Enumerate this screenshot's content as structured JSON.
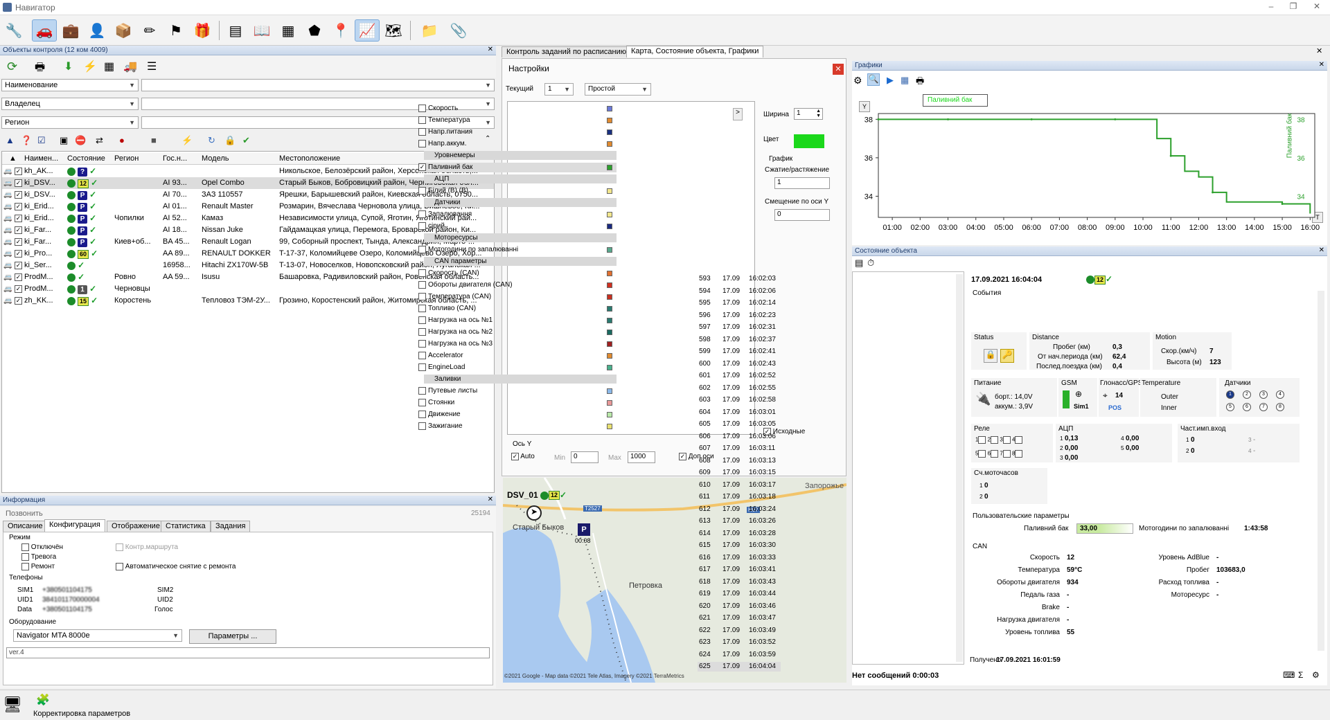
{
  "app": {
    "title": "Навигатор",
    "min": "–",
    "max": "❐",
    "close": "✕"
  },
  "toolbar": {
    "icons": [
      "wrench-icon",
      "car-icon",
      "briefcase-icon",
      "driver-icon",
      "box-icon",
      "wand-icon",
      "flag-icon",
      "parcel-icon",
      "calculator-icon",
      "book-icon",
      "graph-grid-icon",
      "shield-icon",
      "map-pin-icon",
      "chart-icon",
      "map-icon",
      "folder-icon",
      "paperclip-icon"
    ]
  },
  "objects": {
    "header": "Объекты контроля (12 ком 4009)",
    "filters": [
      {
        "label": "Наименование",
        "value": ""
      },
      {
        "label": "Владелец",
        "value": ""
      },
      {
        "label": "Регион",
        "value": ""
      }
    ],
    "columns": [
      "Наимен...",
      "Состояние",
      "Регион",
      "Гос.н...",
      "Модель",
      "Местоположение"
    ],
    "rows": [
      {
        "name": "kh_AK...",
        "st": "?",
        "region": "",
        "gos": "",
        "model": "",
        "loc": "Никольское, Белозёрский район, Херсонская область,..."
      },
      {
        "name": "ki_DSV...",
        "st": "12",
        "region": "",
        "gos": "AI 93...",
        "model": "Opel Combo",
        "loc": "Старый Быков, Бобровицкий район, Черниговская обл..."
      },
      {
        "name": "ki_DSV...",
        "st": "P",
        "region": "",
        "gos": "AI 70...",
        "model": "ЗАЗ  110557",
        "loc": "Ярешки, Барышевский район, Киевская область, 0750..."
      },
      {
        "name": "ki_Erid...",
        "st": "P",
        "region": "",
        "gos": "AI 01...",
        "model": "Renault Master",
        "loc": "Розмарин, Вячеслава Черновола улица, Вишнёвое, Ки..."
      },
      {
        "name": "ki_Erid...",
        "st": "P",
        "region": "Чопилки",
        "gos": "AI 52...",
        "model": "Камаз",
        "loc": "Независимости улица, Супой, Яготин, Яготинский рай..."
      },
      {
        "name": "ki_Far...",
        "st": "P",
        "region": "",
        "gos": "AI 18...",
        "model": "Nissan Juke",
        "loc": "Гайдамацкая улица, Перемога, Броварской район, Ки..."
      },
      {
        "name": "ki_Far...",
        "st": "P",
        "region": "Киев+об...",
        "gos": "BA 45...",
        "model": "Renault Logan",
        "loc": "99, Соборный проспект, Тында, Александрия, Марто-..."
      },
      {
        "name": "ki_Pro...",
        "st": "60",
        "region": "",
        "gos": "AA 89...",
        "model": "RENAULT DOKKER",
        "loc": "T-17-37, Коломийцеве Озеро, Коломийцево Озеро, Хор..."
      },
      {
        "name": "ki_Ser...",
        "st": "",
        "region": "",
        "gos": "16958...",
        "model": "Hitachi ZX170W-5B",
        "loc": "T-13-07, Новоселков, Новопсковский район, Луганская ..."
      },
      {
        "name": "ProdM...",
        "st": "",
        "region": "Ровно",
        "gos": "AA 59...",
        "model": "Isusu",
        "loc": "Башаровка, Радивиловский район, Ровенская область..."
      },
      {
        "name": "ProdM...",
        "st": "1",
        "region": "Черновцы",
        "gos": "",
        "model": "",
        "loc": ""
      },
      {
        "name": "zh_KK...",
        "st": "15",
        "region": "Коростень",
        "gos": "",
        "model": "Тепловоз ТЭМ-2У...",
        "loc": "Грозино, Коростенский район, Житомирская область, ..."
      }
    ]
  },
  "info": {
    "header": "Информация",
    "call": "Позвонить",
    "id": "25194",
    "tabs": [
      "Описание",
      "Конфигурация",
      "Отображение",
      "Статистика",
      "Задания"
    ],
    "mode_title": "Режим",
    "modes": [
      "Отключён",
      "Тревога",
      "Ремонт"
    ],
    "route": "Контр.маршрута",
    "auto": "Автоматическое снятие с ремонта",
    "phones_title": "Телефоны",
    "sim1": "SIM1",
    "sim1_val": "+380501104175",
    "uid1": "UID1",
    "uid1_val": "384101170000004",
    "data": "Data",
    "data_val": "+380501104175",
    "sim2": "SIM2",
    "uid2": "UID2",
    "voice": "Голос",
    "equip_title": "Оборудование",
    "equip": "Navigator MTA 8000e",
    "params_btn": "Параметры ...",
    "ver": "ver.4"
  },
  "tabs_mid": [
    "Контроль заданий по расписанию",
    "Карта, Состояние объекта, Графики"
  ],
  "settings": {
    "title": "Настройки",
    "current_label": "Текущий",
    "current": "1",
    "mode": "Простой",
    "width_label": "Ширина",
    "width": "1",
    "color_label": "Цвет",
    "graph_label": "График",
    "scale_label": "Сжатие/растяжение",
    "scale": "1",
    "offset_label": "Смещение по оси Y",
    "offset": "0",
    "source_label": "Исходные",
    "axis_label": "Ось Y",
    "auto": "Auto",
    "min_label": "Min",
    "min": "0",
    "max_label": "Max",
    "max": "1000",
    "extra": "Доп.оси",
    "items": [
      {
        "t": "row",
        "n": "Скорость",
        "c": "#6b79d8"
      },
      {
        "t": "row",
        "n": "Температура",
        "c": "#e08a30"
      },
      {
        "t": "row",
        "n": "Напр.питания",
        "c": "#1a3080"
      },
      {
        "t": "row",
        "n": "Напр.аккум.",
        "c": "#e08a30"
      },
      {
        "t": "sec",
        "n": "Уровнемеры"
      },
      {
        "t": "row",
        "n": "Паливний бак",
        "c": "#2ca02c",
        "on": true
      },
      {
        "t": "sec",
        "n": "АЦП"
      },
      {
        "t": "row",
        "n": "Білий (В) (В)",
        "c": "#f2e68c"
      },
      {
        "t": "sec",
        "n": "Датчики"
      },
      {
        "t": "row",
        "n": "Запалювання",
        "c": "#f2e68c"
      },
      {
        "t": "row",
        "n": "сірий",
        "c": "#1a2a80"
      },
      {
        "t": "sec",
        "n": "Моторесурсы"
      },
      {
        "t": "row",
        "n": "Мотогодини по запалюванні",
        "c": "#58a88c"
      },
      {
        "t": "sec",
        "n": "CAN параметры"
      },
      {
        "t": "row",
        "n": "Скорость (CAN)",
        "c": "#e07030"
      },
      {
        "t": "row",
        "n": "Обороты двигателя (CAN)",
        "c": "#d03020"
      },
      {
        "t": "row",
        "n": "Температура (CAN)",
        "c": "#c83020"
      },
      {
        "t": "row",
        "n": "Топливо (CAN)",
        "c": "#2a7a70"
      },
      {
        "t": "row",
        "n": "Нагрузка на ось №1",
        "c": "#2a7a70"
      },
      {
        "t": "row",
        "n": "Нагрузка на ось №2",
        "c": "#1a6a60"
      },
      {
        "t": "row",
        "n": "Нагрузка на ось №3",
        "c": "#a02020"
      },
      {
        "t": "row",
        "n": "Accelerator",
        "c": "#e08a30"
      },
      {
        "t": "row",
        "n": "EngineLoad",
        "c": "#4ab08c"
      },
      {
        "t": "sec",
        "n": "Заливки"
      },
      {
        "t": "row",
        "n": "Путевые листы",
        "c": "#8ab8e8"
      },
      {
        "t": "row",
        "n": "Стоянки",
        "c": "#e89898"
      },
      {
        "t": "row",
        "n": "Движение",
        "c": "#b8e8a8"
      },
      {
        "t": "row",
        "n": "Зажигание",
        "c": "#e8e070"
      }
    ]
  },
  "map": {
    "object": "DSV_01",
    "badge": "12",
    "labels": [
      "Запорожье",
      "Старый Быков",
      "Петровка",
      "T2527",
      "H07"
    ],
    "time": "00:08",
    "attribution": "©2021 Google - Map data ©2021 Tele Atlas, Imagery ©2021 TerraMetrics"
  },
  "graphs": {
    "header": "Графики",
    "tooltip": "Паливний бак",
    "series_label": "Паливний бак",
    "y_btn": "Y",
    "t_btn": "T"
  },
  "chart_data": {
    "type": "line",
    "x": [
      "00:00",
      "01:00",
      "02:00",
      "03:00",
      "04:00",
      "05:00",
      "06:00",
      "07:00",
      "08:00",
      "09:00",
      "10:00",
      "10:30",
      "11:00",
      "11:30",
      "12:00",
      "12:30",
      "13:00",
      "14:00",
      "15:00",
      "16:00"
    ],
    "series": [
      {
        "name": "Паливний бак",
        "values": [
          38,
          38,
          38,
          38,
          38,
          38,
          38,
          38,
          38,
          38,
          38,
          37.0,
          36.1,
          35.3,
          35.0,
          34.2,
          33.7,
          33.7,
          33.6,
          33.1
        ]
      }
    ],
    "xticks": [
      "01:00",
      "02:00",
      "03:00",
      "04:00",
      "05:00",
      "06:00",
      "07:00",
      "08:00",
      "09:00",
      "10:00",
      "11:00",
      "12:00",
      "13:00",
      "14:00",
      "15:00",
      "16:00"
    ],
    "yticks": [
      "38",
      "36",
      "34"
    ],
    "ylim": [
      32.9,
      38.3
    ],
    "annotations": [
      "38",
      "36",
      "34"
    ],
    "color": "#2ca02c"
  },
  "state": {
    "header": "Состояние объекта",
    "datetime": "17.09.2021 16:04:04",
    "badge": "12",
    "events": "События",
    "messages": [
      [
        "593",
        "17.09",
        "16:02:03"
      ],
      [
        "594",
        "17.09",
        "16:02:06"
      ],
      [
        "595",
        "17.09",
        "16:02:14"
      ],
      [
        "596",
        "17.09",
        "16:02:23"
      ],
      [
        "597",
        "17.09",
        "16:02:31"
      ],
      [
        "598",
        "17.09",
        "16:02:37"
      ],
      [
        "599",
        "17.09",
        "16:02:41"
      ],
      [
        "600",
        "17.09",
        "16:02:43"
      ],
      [
        "601",
        "17.09",
        "16:02:52"
      ],
      [
        "602",
        "17.09",
        "16:02:55"
      ],
      [
        "603",
        "17.09",
        "16:02:58"
      ],
      [
        "604",
        "17.09",
        "16:03:01"
      ],
      [
        "605",
        "17.09",
        "16:03:05"
      ],
      [
        "606",
        "17.09",
        "16:03:06"
      ],
      [
        "607",
        "17.09",
        "16:03:11"
      ],
      [
        "608",
        "17.09",
        "16:03:13"
      ],
      [
        "609",
        "17.09",
        "16:03:15"
      ],
      [
        "610",
        "17.09",
        "16:03:17"
      ],
      [
        "611",
        "17.09",
        "16:03:18"
      ],
      [
        "612",
        "17.09",
        "16:03:24"
      ],
      [
        "613",
        "17.09",
        "16:03:26"
      ],
      [
        "614",
        "17.09",
        "16:03:28"
      ],
      [
        "615",
        "17.09",
        "16:03:30"
      ],
      [
        "616",
        "17.09",
        "16:03:33"
      ],
      [
        "617",
        "17.09",
        "16:03:41"
      ],
      [
        "618",
        "17.09",
        "16:03:43"
      ],
      [
        "619",
        "17.09",
        "16:03:44"
      ],
      [
        "620",
        "17.09",
        "16:03:46"
      ],
      [
        "621",
        "17.09",
        "16:03:47"
      ],
      [
        "622",
        "17.09",
        "16:03:49"
      ],
      [
        "623",
        "17.09",
        "16:03:52"
      ],
      [
        "624",
        "17.09",
        "16:03:59"
      ],
      [
        "625",
        "17.09",
        "16:04:04"
      ]
    ],
    "nomsg": "Нет сообщений 0:00:03",
    "received_label": "Получено",
    "received": "17.09.2021 16:01:59",
    "status": "Status",
    "distance": "Distance",
    "motion": "Motion",
    "probeg": "Пробег (км)",
    "probeg_v": "0,3",
    "ot_nach": "От нач.периода (км)",
    "ot_nach_v": "62,4",
    "posl": "Послед.поездка (км)",
    "posl_v": "0,4",
    "skor": "Скор.(км/ч)",
    "skor_v": "7",
    "vys": "Высота (м)",
    "vys_v": "123",
    "pitanie": "Питание",
    "bort": "борт.: 14,0V",
    "akkum": "аккум.: 3,9V",
    "gsm": "GSM",
    "sim1": "Sim1",
    "glonass": "Глонасс/GPS",
    "sats": "14",
    "pos": "POS",
    "temp": "Temperature",
    "outer": "Outer",
    "inner": "Inner",
    "datchiki": "Датчики",
    "rele": "Реле",
    "acp": "АЦП",
    "acp_vals": [
      "0,13",
      "0,00",
      "0,00",
      "0,00",
      "0,00"
    ],
    "chast": "Част.имп.вход",
    "chast_vals": [
      "0",
      "0",
      "-",
      "-"
    ],
    "sch": "Сч.моточасов",
    "sch_vals": [
      "0",
      "0"
    ],
    "user_params": "Пользовательские параметры",
    "fuel_lbl": "Паливний бак",
    "fuel": "33,00",
    "motor_lbl": "Мотогодини по запалюванні",
    "motor": "1:43:58",
    "can": "CAN",
    "can_left": [
      [
        "Скорость",
        "12"
      ],
      [
        "Температура",
        "59°C"
      ],
      [
        "Обороты двигателя",
        "934"
      ],
      [
        "Педаль газа",
        "-"
      ],
      [
        "Brake",
        "-"
      ],
      [
        "Нагрузка двигателя",
        "-"
      ],
      [
        "Уровень топлива",
        "55"
      ]
    ],
    "can_right": [
      [
        "Уровень AdBlue",
        "-"
      ],
      [
        "Пробег",
        "103683,0"
      ],
      [
        "Расход топлива",
        "-"
      ],
      [
        "Моторесурс",
        "-"
      ]
    ]
  },
  "statusbar": {
    "text": "Корректировка параметров"
  }
}
